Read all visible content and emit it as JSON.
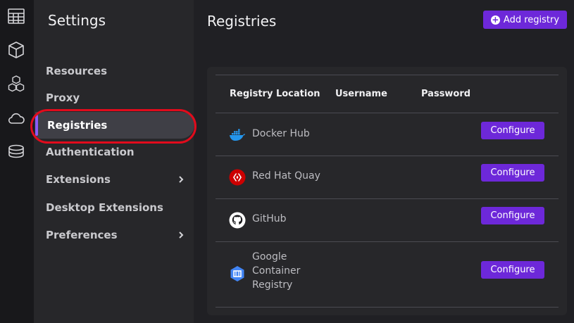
{
  "rail": {
    "icons": [
      "dashboard-icon",
      "container-icon",
      "pods-icon",
      "cloud-icon",
      "volumes-icon"
    ]
  },
  "sidebar": {
    "title": "Settings",
    "items": [
      {
        "label": "Resources",
        "chevron": false
      },
      {
        "label": "Proxy",
        "chevron": false
      },
      {
        "label": "Registries",
        "chevron": false,
        "active": true
      },
      {
        "label": "Authentication",
        "chevron": false
      },
      {
        "label": "Extensions",
        "chevron": true
      },
      {
        "label": "Desktop Extensions",
        "chevron": false
      },
      {
        "label": "Preferences",
        "chevron": true
      }
    ]
  },
  "main": {
    "title": "Registries",
    "add_button": "Add registry",
    "columns": [
      "Registry Location",
      "Username",
      "Password"
    ],
    "registries": [
      {
        "name": "Docker Hub",
        "icon": "docker-icon",
        "action": "Configure"
      },
      {
        "name": "Red Hat Quay",
        "icon": "quay-icon",
        "action": "Configure"
      },
      {
        "name": "GitHub",
        "icon": "github-icon",
        "action": "Configure"
      },
      {
        "name_lines": [
          "Google",
          "Container",
          "Registry"
        ],
        "icon": "gcr-icon",
        "action": "Configure"
      }
    ]
  },
  "colors": {
    "accent": "#6d28d9",
    "highlight_ring": "#e10b1c",
    "sidebar_bg": "#27272a",
    "page_bg": "#202024"
  }
}
